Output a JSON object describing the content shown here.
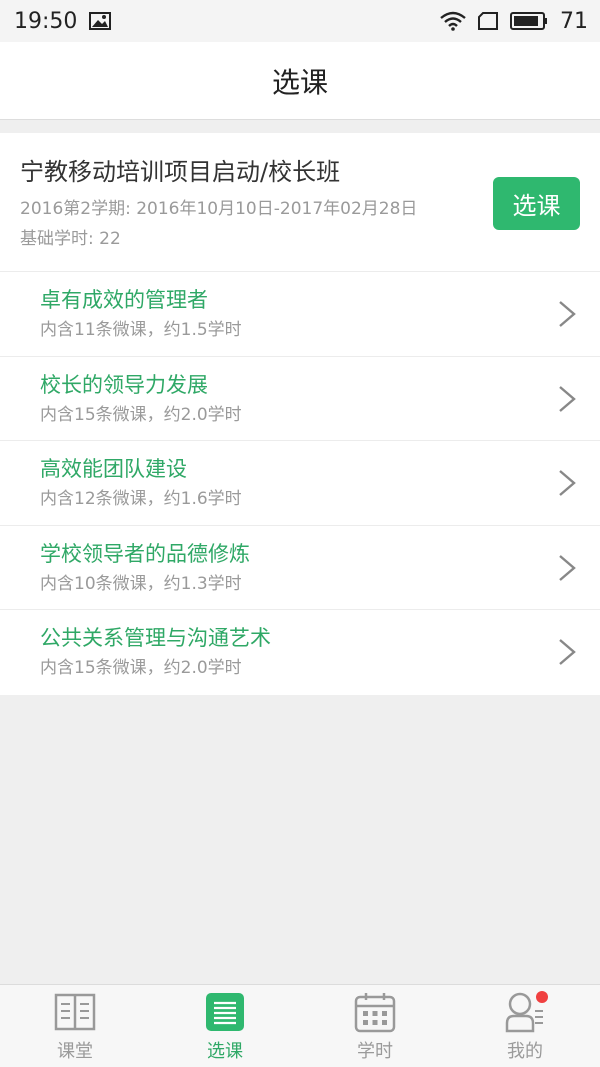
{
  "status": {
    "time": "19:50",
    "battery": "71",
    "icons": [
      "image-icon",
      "wifi-icon",
      "sim-icon",
      "battery-icon"
    ]
  },
  "nav": {
    "title": "选课"
  },
  "course": {
    "title": "宁教移动培训项目启动/校长班",
    "period": "2016第2学期: 2016年10月10日-2017年02月28日",
    "base_hours": "基础学时: 22",
    "select_label": "选课",
    "modules": [
      {
        "title": "卓有成效的管理者",
        "sub": "内含11条微课，约1.5学时"
      },
      {
        "title": "校长的领导力发展",
        "sub": "内含15条微课，约2.0学时"
      },
      {
        "title": "高效能团队建设",
        "sub": "内含12条微课，约1.6学时"
      },
      {
        "title": "学校领导者的品德修炼",
        "sub": "内含10条微课，约1.3学时"
      },
      {
        "title": "公共关系管理与沟通艺术",
        "sub": "内含15条微课，约2.0学时"
      }
    ]
  },
  "tabs": [
    {
      "label": "课堂",
      "icon": "book-icon",
      "active": false
    },
    {
      "label": "选课",
      "icon": "list-icon",
      "active": true
    },
    {
      "label": "学时",
      "icon": "calendar-icon",
      "active": false
    },
    {
      "label": "我的",
      "icon": "profile-icon",
      "active": false
    }
  ],
  "colors": {
    "accent": "#2fb86f",
    "accent_text": "#2fa866",
    "badge": "#f04040"
  }
}
